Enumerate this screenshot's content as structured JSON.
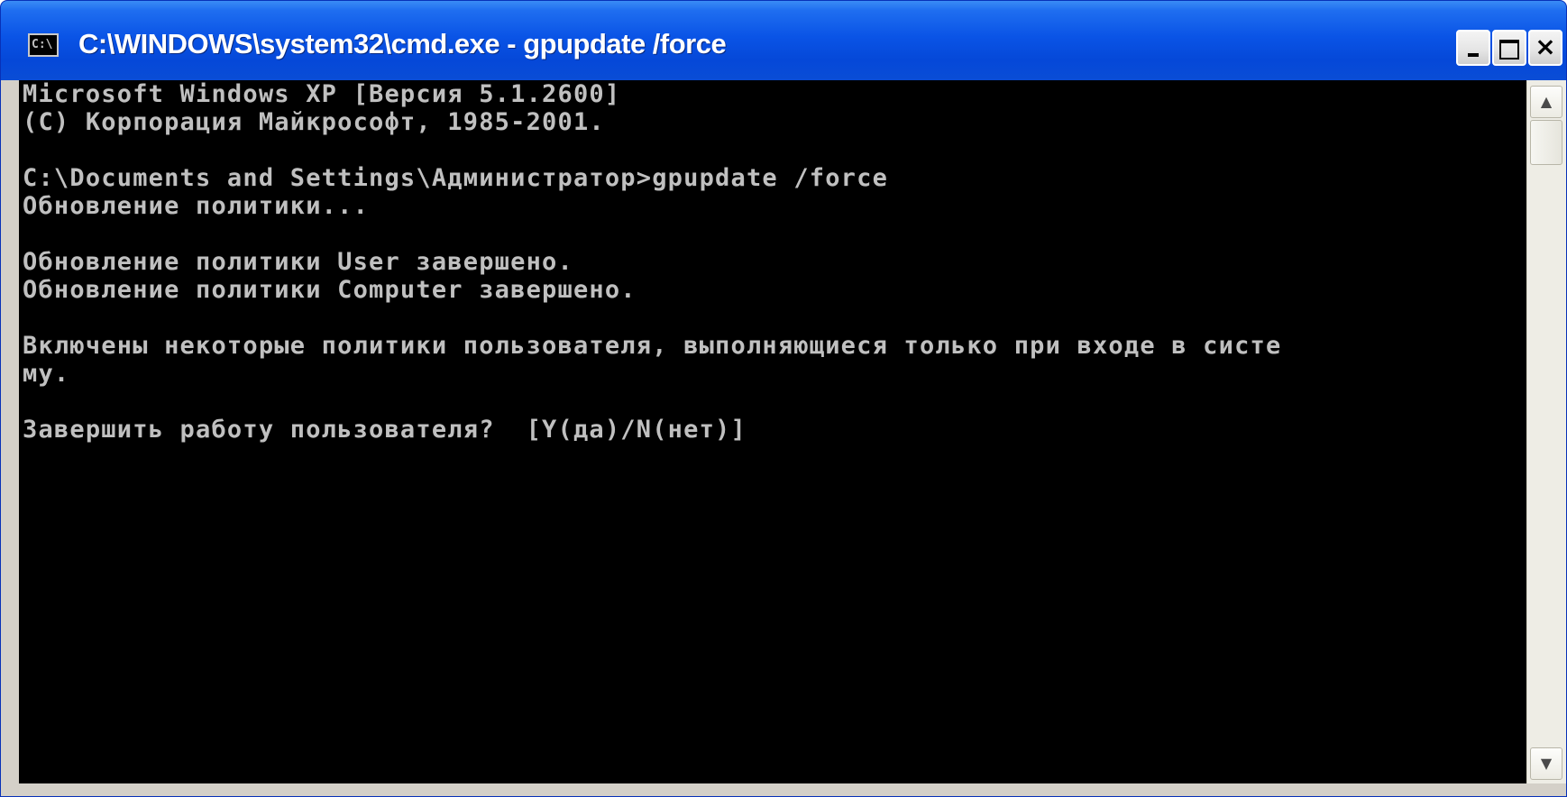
{
  "window": {
    "title": "C:\\WINDOWS\\system32\\cmd.exe - gpupdate /force",
    "icon_label": "C:\\",
    "icon": "console-icon",
    "buttons": {
      "minimize": "minimize-icon",
      "maximize": "maximize-icon",
      "close_label": "×"
    }
  },
  "console": {
    "lines": [
      "Microsoft Windows XP [Версия 5.1.2600]",
      "(С) Корпорация Майкрософт, 1985-2001.",
      "",
      "C:\\Documents and Settings\\Администратор>gpupdate /force",
      "Обновление политики...",
      "",
      "Обновление политики User завершено.",
      "Обновление политики Computer завершено.",
      "",
      "Включены некоторые политики пользователя, выполняющиеся только при входе в систе",
      "му.",
      "",
      "Завершить работу пользователя?  [Y(да)/N(нет)]"
    ]
  },
  "scrollbar": {
    "up_arrow": "▲",
    "down_arrow": "▼"
  },
  "colors": {
    "titlebar": "#0a54e6",
    "console_bg": "#000000",
    "console_text": "#c0c0c0",
    "frame": "#d4d0c8"
  }
}
